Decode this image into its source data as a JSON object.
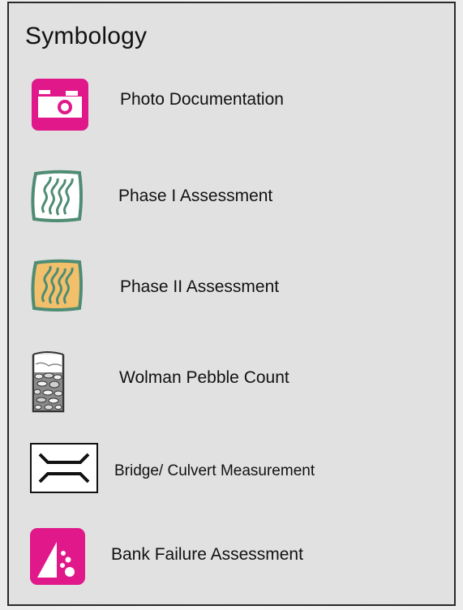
{
  "legend": {
    "title": "Symbology",
    "items": [
      {
        "label": "Photo Documentation",
        "icon": "camera-icon",
        "color": "#e0188a"
      },
      {
        "label": "Phase I Assessment",
        "icon": "stream-lines-icon",
        "color": "#4f8c74"
      },
      {
        "label": "Phase II Assessment",
        "icon": "stream-lines-orange-icon",
        "color": "#f2c06b"
      },
      {
        "label": "Wolman Pebble Count",
        "icon": "pebble-beaker-icon",
        "color": "#777777"
      },
      {
        "label": "Bridge/ Culvert Measurement",
        "icon": "bridge-culvert-icon",
        "color": "#000000"
      },
      {
        "label": "Bank Failure Assessment",
        "icon": "bank-failure-icon",
        "color": "#e0188a"
      }
    ]
  }
}
